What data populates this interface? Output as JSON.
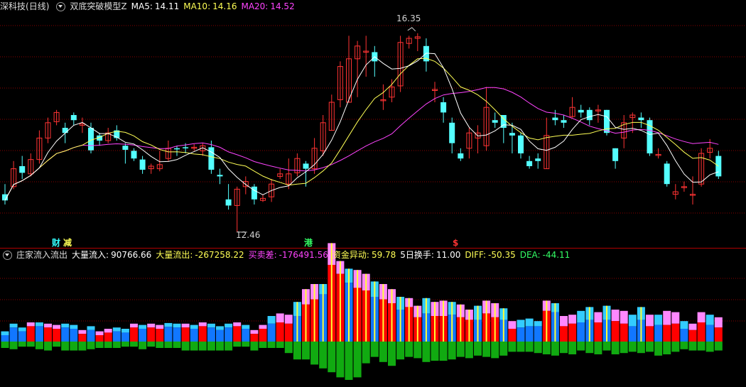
{
  "upper": {
    "stock_name": "深科技",
    "period": "(日线)",
    "indicator": "双底突破模型Z",
    "ma5": {
      "label": "MA5:",
      "value": "14.11",
      "color": "#ffffff"
    },
    "ma10": {
      "label": "MA10:",
      "value": "14.16",
      "color": "#ffff55"
    },
    "ma20": {
      "label": "MA20:",
      "value": "14.52",
      "color": "#ff44ff"
    },
    "high_label": "16.35",
    "low_label": "12.46",
    "signals": [
      {
        "text": "财",
        "color": "#33ffff"
      },
      {
        "text": "减",
        "color": "#ffff55"
      },
      {
        "text": "港",
        "color": "#33ff66"
      },
      {
        "text": "$",
        "color": "#ff3333"
      }
    ]
  },
  "lower": {
    "indicator": "庄家流入流出",
    "fields": [
      {
        "label": "大量流入:",
        "value": "90766.66",
        "color": "#ffffff"
      },
      {
        "label": "大量流出:",
        "value": "-267258.22",
        "color": "#ffff55"
      },
      {
        "label": "买卖差:",
        "value": "-176491.56",
        "color": "#ff44ff"
      },
      {
        "label": "资金异动:",
        "value": "59.78",
        "color": "#ffff55"
      },
      {
        "label": "5日换手:",
        "value": "11.00",
        "color": "#ffffff"
      },
      {
        "label": "DIFF:",
        "value": "-50.35",
        "color": "#ffff55"
      },
      {
        "label": "DEA:",
        "value": "-44.11",
        "color": "#33ff66"
      }
    ]
  },
  "colors": {
    "up": "#ff3333",
    "down": "#54ffff",
    "grid": "#8a0000"
  },
  "chart_data": {
    "type": "candlestick",
    "candles": [
      [
        13.2,
        13.08,
        13.4,
        13.0
      ],
      [
        13.35,
        13.7,
        13.85,
        13.3
      ],
      [
        13.75,
        13.62,
        13.95,
        13.5
      ],
      [
        13.6,
        13.88,
        14.0,
        13.55
      ],
      [
        13.88,
        14.3,
        14.45,
        13.8
      ],
      [
        14.3,
        14.6,
        14.7,
        14.2
      ],
      [
        14.62,
        14.8,
        14.85,
        14.55
      ],
      [
        14.5,
        14.4,
        14.6,
        14.2
      ],
      [
        14.75,
        14.65,
        14.8,
        14.55
      ],
      [
        14.55,
        14.58,
        14.7,
        14.4
      ],
      [
        14.5,
        14.06,
        14.6,
        14.0
      ],
      [
        14.35,
        14.25,
        14.4,
        14.15
      ],
      [
        14.25,
        14.4,
        14.5,
        14.2
      ],
      [
        14.45,
        14.3,
        14.55,
        14.25
      ],
      [
        14.15,
        14.07,
        14.2,
        13.8
      ],
      [
        14.05,
        13.9,
        14.1,
        13.85
      ],
      [
        13.88,
        13.68,
        13.95,
        13.6
      ],
      [
        13.7,
        13.75,
        13.8,
        13.6
      ],
      [
        13.7,
        13.78,
        14.05,
        13.65
      ],
      [
        13.9,
        14.1,
        14.25,
        13.85
      ],
      [
        14.1,
        14.08,
        14.15,
        13.95
      ],
      [
        14.12,
        14.1,
        14.2,
        14.0
      ],
      [
        14.12,
        14.12,
        14.18,
        14.05
      ],
      [
        14.05,
        14.15,
        14.2,
        13.95
      ],
      [
        14.12,
        13.68,
        14.25,
        13.6
      ],
      [
        13.58,
        13.55,
        13.7,
        13.4
      ],
      [
        13.1,
        12.98,
        13.4,
        12.9
      ],
      [
        12.98,
        13.3,
        13.35,
        12.46
      ],
      [
        13.35,
        13.45,
        13.55,
        13.2
      ],
      [
        13.35,
        13.1,
        13.4,
        13.0
      ],
      [
        13.08,
        13.12,
        13.2,
        13.05
      ],
      [
        13.15,
        13.4,
        13.5,
        13.05
      ],
      [
        13.55,
        13.6,
        13.7,
        13.5
      ],
      [
        13.4,
        13.6,
        13.9,
        13.3
      ],
      [
        13.62,
        13.9,
        14.0,
        13.55
      ],
      [
        13.8,
        13.7,
        13.85,
        13.35
      ],
      [
        13.7,
        14.1,
        14.3,
        13.6
      ],
      [
        14.05,
        14.6,
        14.75,
        13.95
      ],
      [
        14.45,
        15.0,
        15.15,
        14.45
      ],
      [
        15.05,
        15.7,
        15.8,
        14.9
      ],
      [
        15.0,
        15.85,
        16.3,
        15.0
      ],
      [
        15.85,
        16.1,
        16.2,
        15.1
      ],
      [
        16.0,
        16.0,
        16.3,
        15.5
      ],
      [
        15.98,
        15.8,
        16.1,
        15.5
      ],
      [
        15.05,
        15.05,
        15.35,
        14.85
      ],
      [
        15.1,
        15.3,
        15.45,
        15.0
      ],
      [
        15.32,
        16.17,
        16.3,
        15.2
      ],
      [
        16.15,
        16.25,
        16.3,
        16.05
      ],
      [
        16.25,
        16.28,
        16.35,
        16.0
      ],
      [
        16.1,
        15.8,
        16.25,
        15.6
      ],
      [
        15.25,
        15.25,
        15.4,
        15.0
      ],
      [
        15.0,
        14.8,
        15.1,
        14.6
      ],
      [
        14.6,
        14.2,
        14.7,
        14.0
      ],
      [
        14.0,
        13.9,
        14.1,
        13.85
      ],
      [
        14.1,
        14.4,
        14.5,
        13.9
      ],
      [
        14.3,
        14.4,
        14.55,
        14.0
      ],
      [
        14.15,
        14.9,
        15.3,
        14.05
      ],
      [
        14.65,
        14.6,
        14.8,
        14.5
      ],
      [
        14.75,
        14.5,
        14.75,
        14.2
      ],
      [
        14.4,
        14.35,
        14.6,
        14.0
      ],
      [
        14.35,
        14.0,
        14.4,
        13.9
      ],
      [
        13.85,
        13.75,
        13.95,
        13.7
      ],
      [
        13.9,
        13.85,
        14.0,
        13.7
      ],
      [
        13.7,
        14.35,
        14.7,
        13.7
      ],
      [
        14.7,
        14.65,
        14.85,
        14.55
      ],
      [
        14.65,
        14.6,
        14.75,
        14.5
      ],
      [
        14.72,
        14.9,
        15.1,
        14.7
      ],
      [
        14.85,
        14.8,
        14.95,
        14.7
      ],
      [
        14.85,
        14.65,
        14.9,
        14.55
      ],
      [
        14.85,
        14.85,
        14.95,
        14.6
      ],
      [
        14.85,
        14.4,
        14.85,
        14.35
      ],
      [
        14.1,
        13.85,
        14.1,
        13.7
      ],
      [
        14.3,
        14.6,
        14.75,
        14.1
      ],
      [
        14.7,
        14.75,
        14.8,
        14.4
      ],
      [
        14.7,
        14.65,
        14.8,
        14.5
      ],
      [
        14.65,
        14.0,
        14.7,
        13.95
      ],
      [
        13.98,
        13.98,
        14.1,
        13.9
      ],
      [
        13.8,
        13.4,
        13.85,
        13.35
      ],
      [
        13.2,
        13.25,
        13.4,
        13.1
      ],
      [
        13.35,
        13.35,
        13.45,
        13.25
      ],
      [
        13.18,
        13.2,
        13.55,
        13.0
      ],
      [
        13.4,
        14.0,
        14.1,
        13.35
      ],
      [
        14.02,
        14.1,
        14.28,
        13.9
      ],
      [
        13.95,
        13.55,
        14.05,
        13.5
      ]
    ],
    "ylim": [
      12.0,
      17.0
    ]
  },
  "flow_data": {
    "type": "bar",
    "inflow": [
      10,
      22,
      16,
      24,
      24,
      22,
      20,
      22,
      20,
      12,
      18,
      10,
      14,
      16,
      14,
      22,
      20,
      22,
      20,
      23,
      22,
      22,
      20,
      24,
      22,
      18,
      22,
      24,
      20,
      12,
      20,
      28,
      30,
      28,
      40,
      58,
      66,
      74,
      120,
      106,
      92,
      84,
      80,
      70,
      66,
      60,
      50,
      54,
      38,
      44,
      40,
      40,
      42,
      38,
      34,
      34,
      44,
      38,
      34,
      20,
      22,
      24,
      24,
      48,
      46,
      24,
      28,
      30,
      34,
      30,
      34,
      32,
      28,
      24,
      34,
      24,
      26,
      26,
      28,
      20,
      18,
      30,
      26,
      22
    ],
    "inflow_top": [
      6,
      6,
      6,
      6,
      6,
      6,
      6,
      6,
      6,
      6,
      6,
      6,
      6,
      6,
      6,
      6,
      6,
      6,
      6,
      6,
      6,
      6,
      6,
      6,
      6,
      6,
      6,
      6,
      6,
      6,
      6,
      12,
      14,
      14,
      22,
      24,
      24,
      16,
      34,
      20,
      22,
      28,
      26,
      24,
      24,
      22,
      20,
      14,
      18,
      24,
      22,
      24,
      20,
      20,
      16,
      22,
      20,
      22,
      18,
      12,
      12,
      12,
      8,
      16,
      14,
      16,
      14,
      18,
      20,
      16,
      22,
      18,
      20,
      18,
      20,
      18,
      16,
      22,
      18,
      12,
      10,
      16,
      16,
      16
    ],
    "outflow": [
      10,
      12,
      8,
      8,
      12,
      14,
      8,
      14,
      14,
      14,
      12,
      10,
      10,
      10,
      8,
      8,
      12,
      8,
      10,
      10,
      10,
      14,
      14,
      14,
      14,
      14,
      14,
      8,
      8,
      14,
      10,
      10,
      10,
      18,
      28,
      28,
      36,
      42,
      48,
      56,
      60,
      56,
      34,
      24,
      32,
      38,
      28,
      24,
      26,
      32,
      30,
      30,
      28,
      24,
      26,
      22,
      24,
      26,
      22,
      16,
      16,
      16,
      18,
      20,
      22,
      18,
      20,
      14,
      18,
      20,
      14,
      20,
      18,
      16,
      18,
      16,
      22,
      20,
      16,
      12,
      14,
      14,
      16,
      14
    ]
  }
}
